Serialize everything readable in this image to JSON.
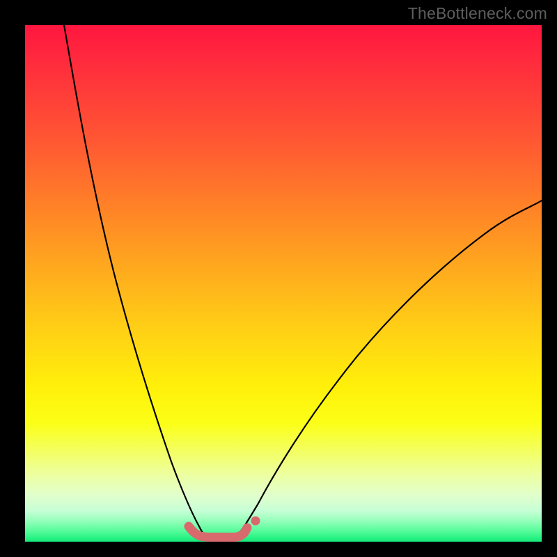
{
  "watermark": "TheBottleneck.com",
  "chart_data": {
    "type": "line",
    "title": "",
    "xlabel": "",
    "ylabel": "",
    "xlim": [
      0,
      100
    ],
    "ylim": [
      0,
      100
    ],
    "note": "Axes unlabeled; values are normalized to 0–100 viewport units read from pixel positions. y=0 is the bottom (green) edge, y=100 is the top (red) edge.",
    "series": [
      {
        "name": "left-curve",
        "x": [
          7.5,
          10,
          15,
          20,
          25,
          27,
          30,
          31.5,
          33,
          34.3
        ],
        "y": [
          100,
          87,
          63,
          42,
          22.5,
          14.5,
          5,
          2.5,
          1.4,
          1.0
        ]
      },
      {
        "name": "right-curve",
        "x": [
          41.0,
          42.5,
          44.3,
          48,
          53,
          60,
          70,
          82,
          92,
          100
        ],
        "y": [
          1.0,
          1.6,
          3.2,
          9.5,
          17.5,
          28,
          40,
          52,
          60,
          66
        ]
      },
      {
        "name": "marker-trough",
        "style": "thick-rounded",
        "color": "#d86a6d",
        "x": [
          31.7,
          32.4,
          33.2,
          34.0,
          34.6,
          38.0,
          40.6,
          41.2,
          41.9,
          42.6
        ],
        "y": [
          3.0,
          2.2,
          1.6,
          1.2,
          1.0,
          1.0,
          1.0,
          1.2,
          1.6,
          2.5
        ]
      },
      {
        "name": "marker-dot",
        "style": "dot",
        "color": "#d86a6d",
        "x": [
          44.6
        ],
        "y": [
          4.0
        ]
      }
    ],
    "background_gradient": {
      "direction": "vertical",
      "stops": [
        {
          "pos": 0.0,
          "color": "#ff163f"
        },
        {
          "pos": 0.22,
          "color": "#ff5633"
        },
        {
          "pos": 0.47,
          "color": "#ffa91e"
        },
        {
          "pos": 0.7,
          "color": "#fff00a"
        },
        {
          "pos": 0.87,
          "color": "#edffa0"
        },
        {
          "pos": 0.96,
          "color": "#94ffba"
        },
        {
          "pos": 1.0,
          "color": "#17e879"
        }
      ]
    }
  }
}
